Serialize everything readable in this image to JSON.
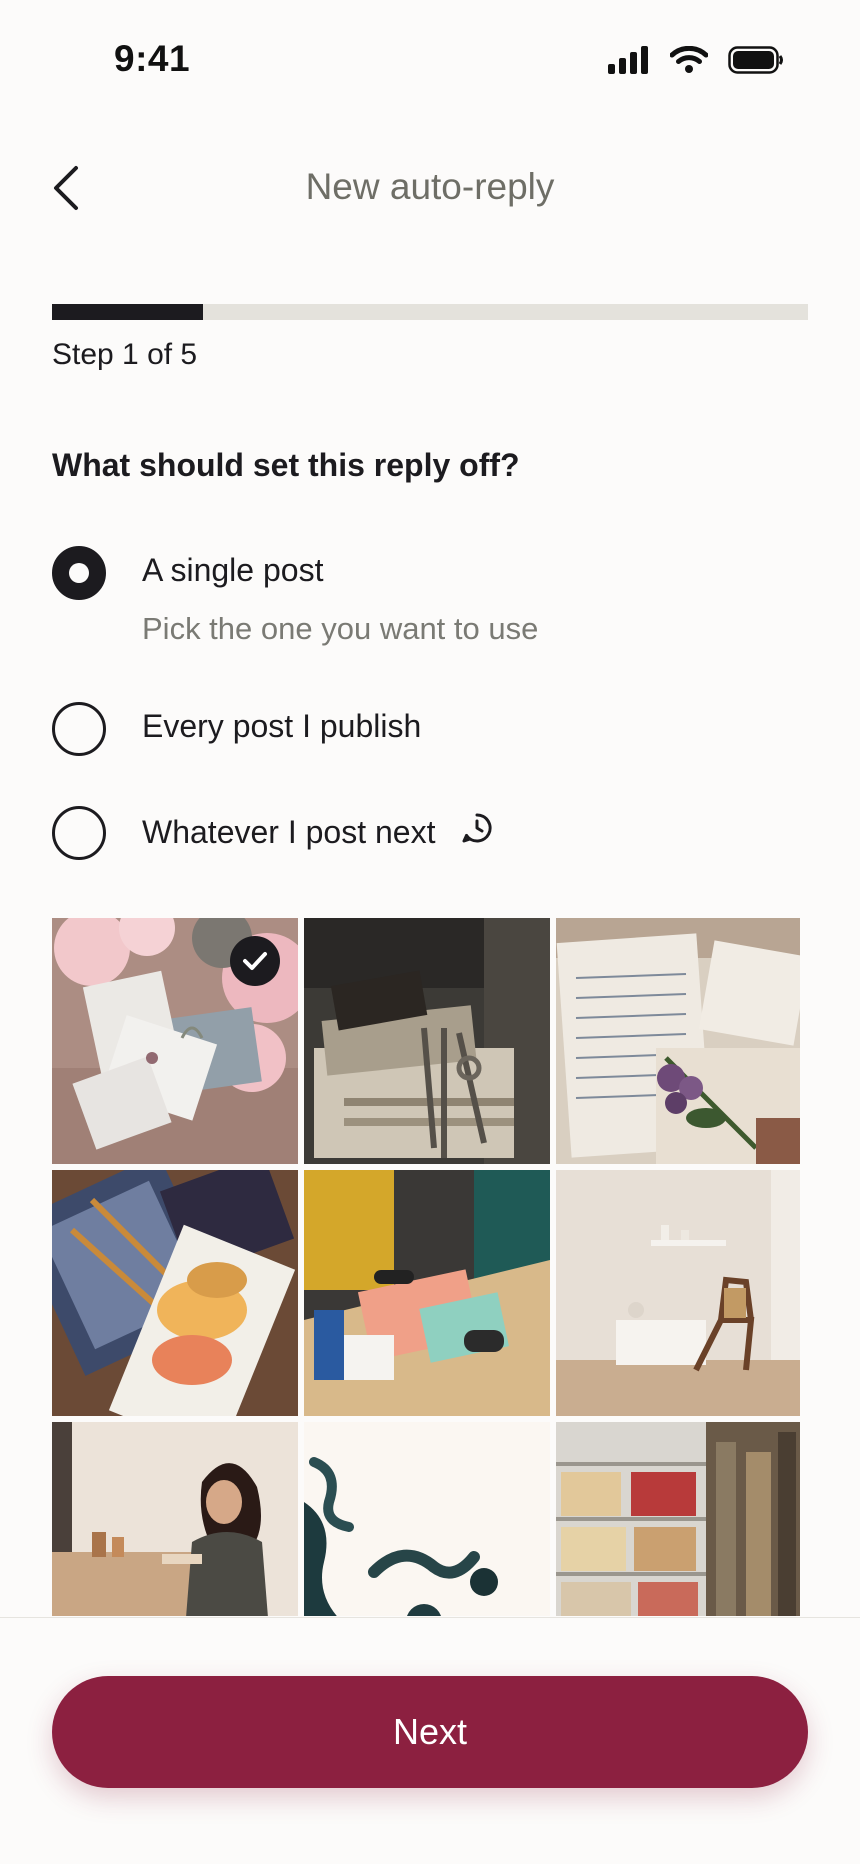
{
  "status_bar": {
    "time": "9:41"
  },
  "header": {
    "title": "New auto-reply"
  },
  "progress": {
    "label": "Step 1 of 5",
    "current_step": 1,
    "total_steps": 5
  },
  "question": "What should set this reply off?",
  "options": [
    {
      "label": "A single post",
      "sublabel": "Pick the one you want to use",
      "selected": true
    },
    {
      "label": "Every post I publish",
      "selected": false
    },
    {
      "label": "Whatever I post next",
      "selected": false,
      "icon": "clock-icon"
    }
  ],
  "posts": [
    {
      "subject": "letters-and-roses",
      "selected": true
    },
    {
      "subject": "old-books-and-keys",
      "selected": false
    },
    {
      "subject": "handwritten-letter-with-flowers",
      "selected": false
    },
    {
      "subject": "watercolor-paintings",
      "selected": false
    },
    {
      "subject": "printmaking-workshop",
      "selected": false
    },
    {
      "subject": "minimal-room-with-chair",
      "selected": false
    },
    {
      "subject": "woman-painting-at-table",
      "selected": false
    },
    {
      "subject": "ink-in-water",
      "selected": false
    },
    {
      "subject": "bookshelf",
      "selected": false
    }
  ],
  "footer": {
    "next_label": "Next"
  },
  "colors": {
    "accent": "#8c2040",
    "text": "#1c1b1f",
    "muted": "#7a7a74",
    "background": "#fcfbfa"
  }
}
